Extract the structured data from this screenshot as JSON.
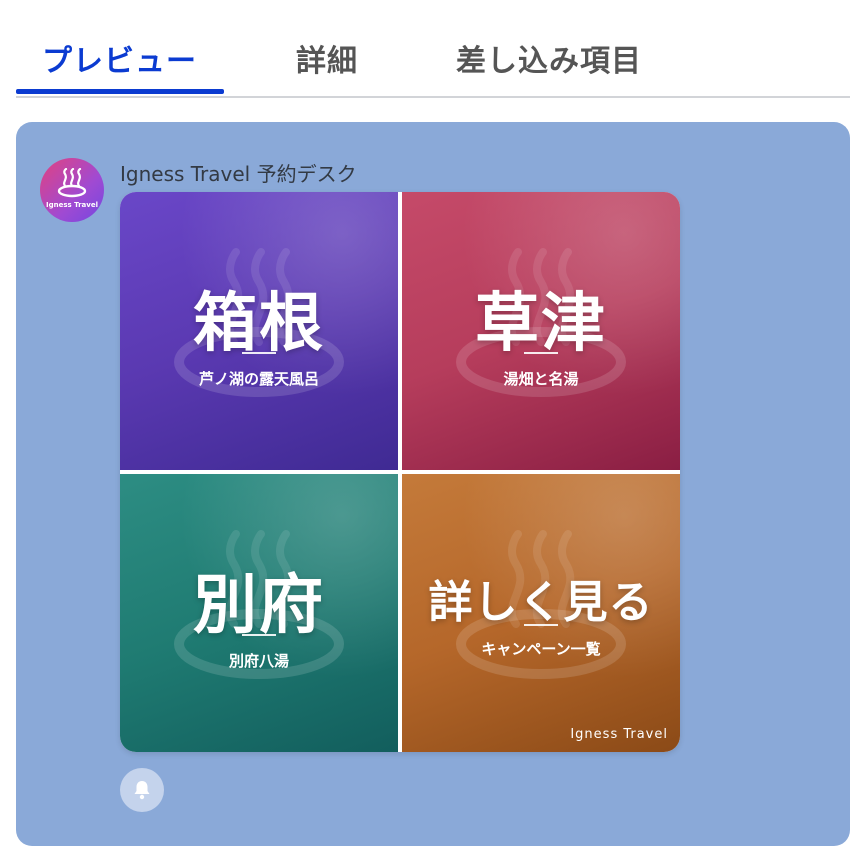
{
  "tabs": [
    {
      "label": "プレビュー",
      "active": true
    },
    {
      "label": "詳細",
      "active": false
    },
    {
      "label": "差し込み項目",
      "active": false
    }
  ],
  "chat": {
    "background_color": "#8aa9d8",
    "avatar": {
      "label": "Igness Travel",
      "icon": "hot-spring-icon"
    },
    "sender_name": "Igness Travel 予約デスク",
    "rich_menu": {
      "tiles": [
        {
          "title": "箱根",
          "subtitle": "芦ノ湖の露天風呂",
          "color": "#5a39b1"
        },
        {
          "title": "草津",
          "subtitle": "湯畑と名湯",
          "color": "#b63d5c"
        },
        {
          "title": "別府",
          "subtitle": "別府八湯",
          "color": "#1f7b72"
        },
        {
          "title": "詳しく見る",
          "subtitle": "キャンペーン一覧",
          "color": "#b5672a"
        }
      ],
      "brand": "Igness Travel"
    },
    "notification_icon": "bell-icon"
  }
}
